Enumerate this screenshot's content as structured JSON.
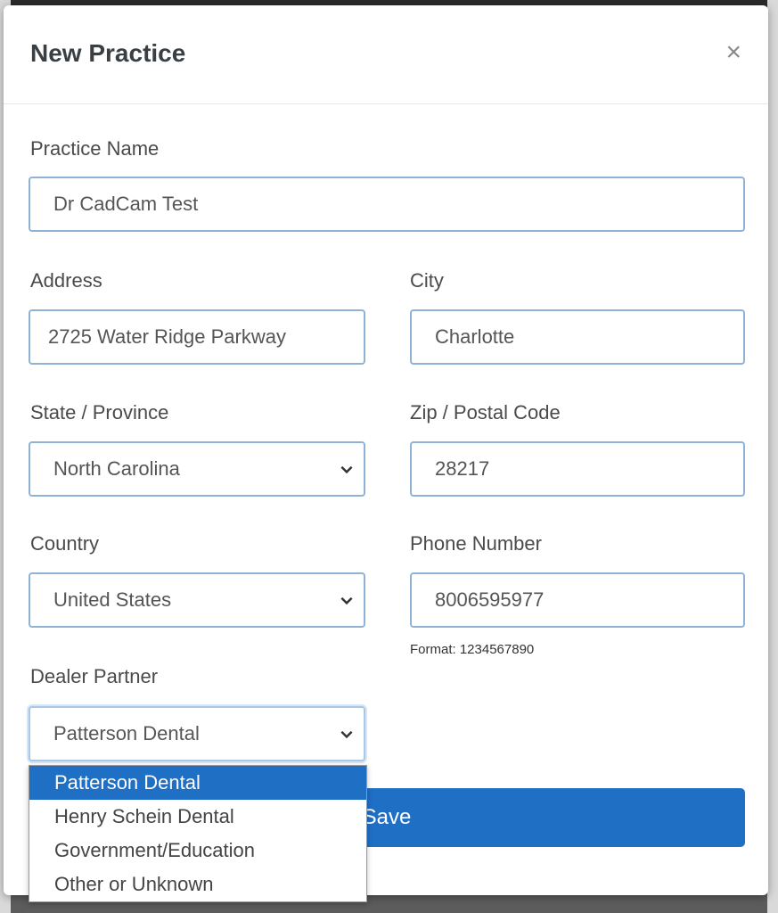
{
  "modal": {
    "title": "New Practice",
    "close_symbol": "×"
  },
  "form": {
    "practice_name": {
      "label": "Practice Name",
      "value": "Dr CadCam Test"
    },
    "address": {
      "label": "Address",
      "value": "2725 Water Ridge Parkway"
    },
    "city": {
      "label": "City",
      "value": "Charlotte"
    },
    "state": {
      "label": "State / Province",
      "value": "North Carolina"
    },
    "zip": {
      "label": "Zip / Postal Code",
      "value": "28217"
    },
    "country": {
      "label": "Country",
      "value": "United States"
    },
    "phone": {
      "label": "Phone Number",
      "value": "8006595977",
      "helper": "Format: 1234567890"
    },
    "dealer": {
      "label": "Dealer Partner",
      "value": "Patterson Dental",
      "options": [
        "Patterson Dental",
        "Henry Schein Dental",
        "Government/Education",
        "Other or Unknown"
      ],
      "highlighted_index": 0
    },
    "save_label": "Save"
  },
  "colors": {
    "primary": "#1f6fc5",
    "input_border": "#8fb3d6"
  },
  "icons": {
    "close": "close-icon",
    "chevron": "chevron-down-icon"
  }
}
